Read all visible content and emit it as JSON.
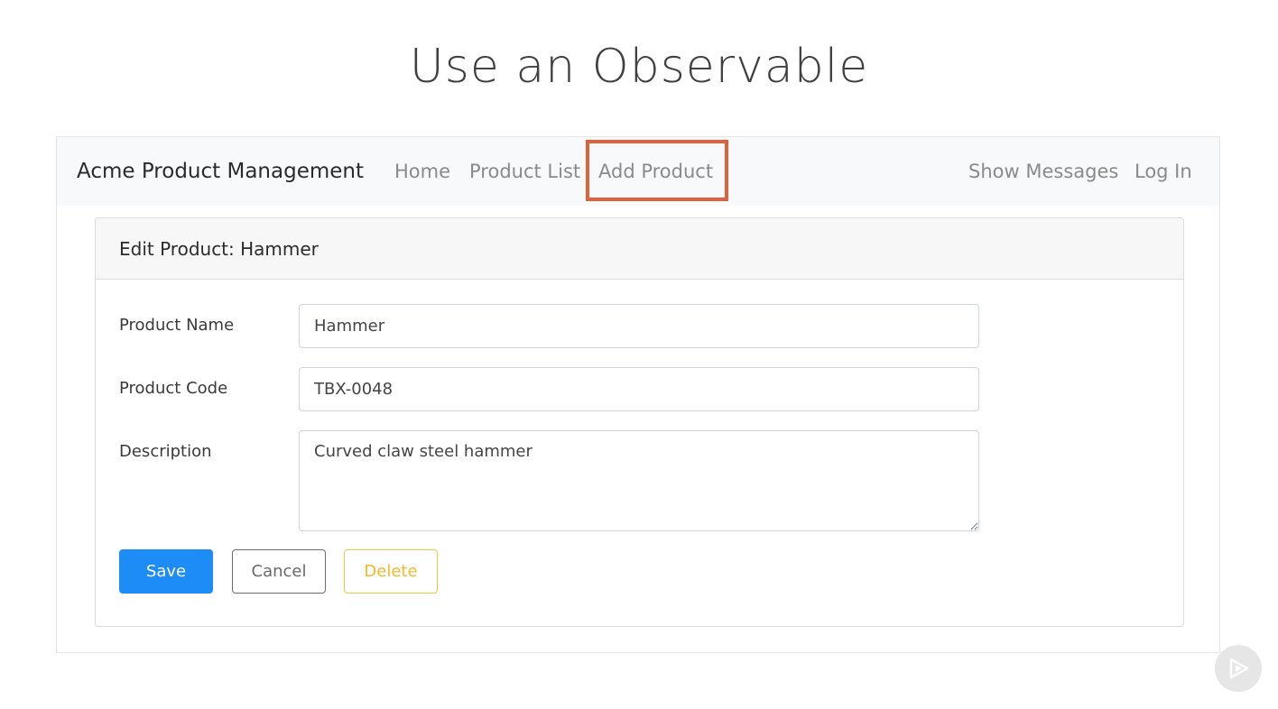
{
  "slide": {
    "title": "Use an Observable"
  },
  "navbar": {
    "brand": "Acme Product Management",
    "links": [
      {
        "label": "Home"
      },
      {
        "label": "Product List"
      },
      {
        "label": "Add Product"
      }
    ],
    "right_links": [
      {
        "label": "Show Messages"
      },
      {
        "label": "Log In"
      }
    ],
    "highlight_color": "#e0623b"
  },
  "card": {
    "title": "Edit Product: Hammer",
    "fields": {
      "product_name": {
        "label": "Product Name",
        "value": "Hammer"
      },
      "product_code": {
        "label": "Product Code",
        "value": "TBX-0048"
      },
      "description": {
        "label": "Description",
        "value": "Curved claw steel hammer"
      }
    },
    "buttons": {
      "save": "Save",
      "cancel": "Cancel",
      "delete": "Delete"
    }
  },
  "colors": {
    "primary": "#1e8cf7",
    "warning": "#f4c542",
    "secondary": "#6c6c6c"
  },
  "icons": {
    "badge": "play-icon"
  }
}
